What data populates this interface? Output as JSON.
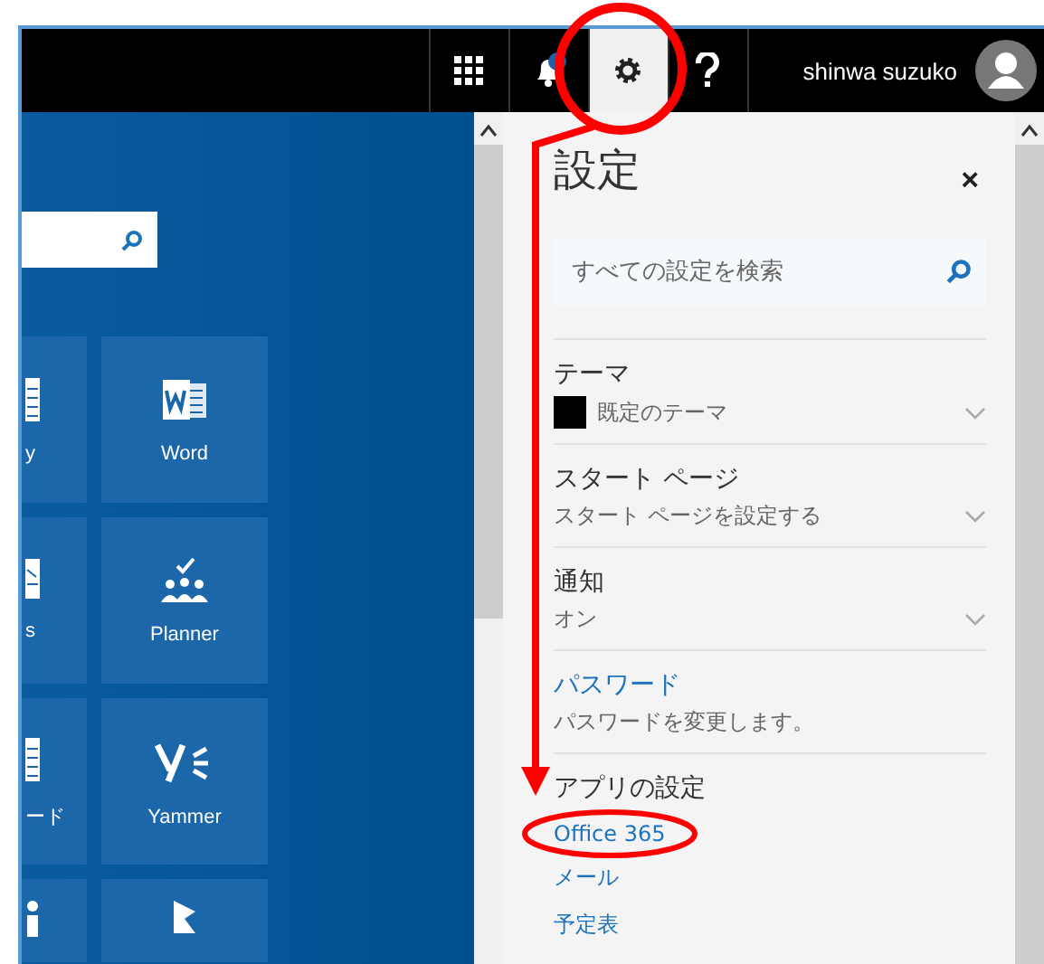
{
  "top_bar": {
    "user_name": "shinwa suzuko",
    "settings_selected": true
  },
  "tiles": [
    {
      "kind": "partial-doc",
      "label": "y"
    },
    {
      "kind": "word",
      "label": "Word"
    },
    {
      "kind": "partial-form",
      "label": "s"
    },
    {
      "kind": "planner",
      "label": "Planner"
    },
    {
      "kind": "partial-doc",
      "label": "ード"
    },
    {
      "kind": "yammer",
      "label": "Yammer"
    },
    {
      "kind": "partial-i"
    },
    {
      "kind": "dynamics"
    }
  ],
  "settings": {
    "title": "設定",
    "close": "×",
    "search": {
      "placeholder": "すべての設定を検索"
    },
    "sections": [
      {
        "kind": "theme",
        "title": "テーマ",
        "value": "既定のテーマ"
      },
      {
        "kind": "dropdown",
        "title": "スタート ページ",
        "value": "スタート ページを設定する"
      },
      {
        "kind": "dropdown",
        "title": "通知",
        "value": "オン"
      },
      {
        "kind": "link",
        "title": "パスワード",
        "value": "パスワードを変更します。"
      }
    ],
    "app_settings": {
      "title": "アプリの設定",
      "links": [
        "Office 365",
        "メール",
        "予定表"
      ]
    }
  }
}
